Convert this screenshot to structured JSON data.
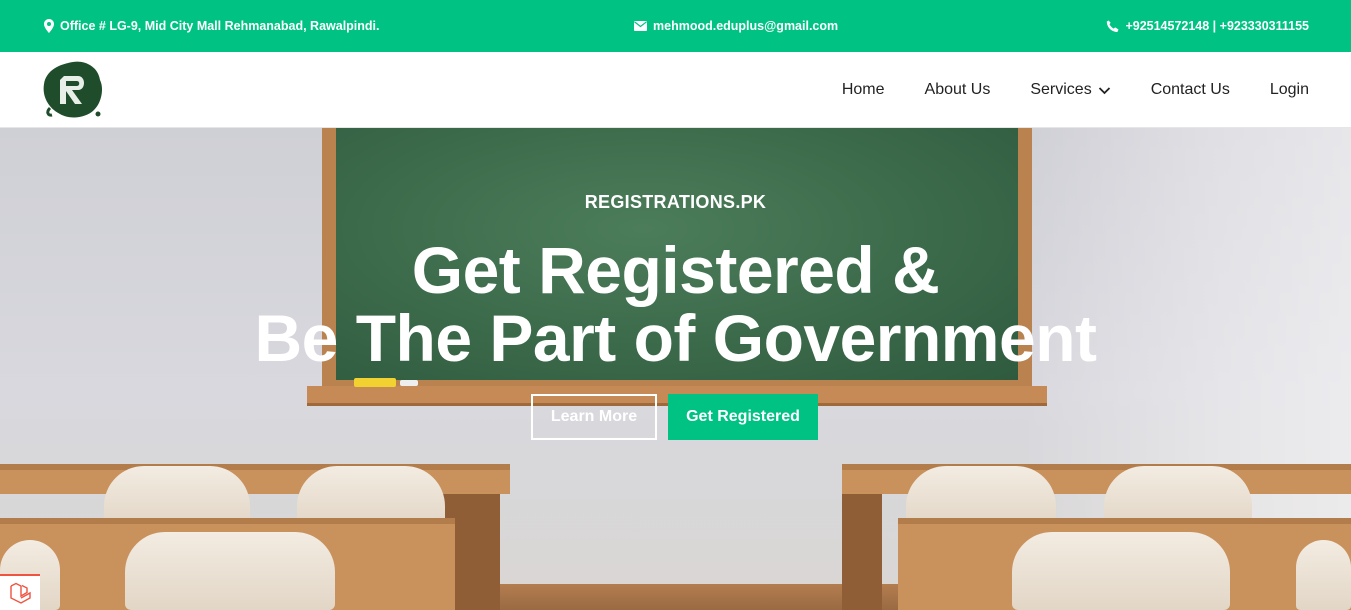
{
  "topbar": {
    "address": "Office # LG-9, Mid City Mall Rehmanabad, Rawalpindi.",
    "email": "mehmood.eduplus@gmail.com",
    "phone": "+92514572148 | +923330311155",
    "icons": [
      "map-marker-icon",
      "envelope-icon",
      "phone-icon"
    ],
    "background": "#00c383"
  },
  "nav": {
    "logo_icon": "registrations-logo-icon",
    "items": [
      "Home",
      "About Us",
      "Services",
      "Contact Us",
      "Login"
    ]
  },
  "hero": {
    "subtitle": "REGISTRATIONS.PK",
    "title_line1": "Get Registered &",
    "title_line2": "Be The Part of Government",
    "learn_more": "Learn More",
    "get_registered": "Get Registered",
    "accent": "#00c383"
  }
}
